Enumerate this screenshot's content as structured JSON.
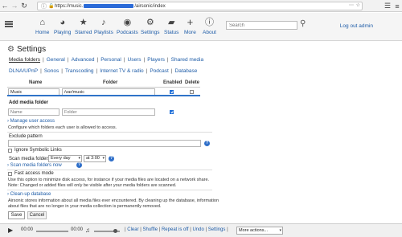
{
  "browser": {
    "back_icon": "arrow-left-icon",
    "forward_icon": "arrow-right-icon",
    "reload_icon": "reload-icon",
    "url_prefix": "https://music.",
    "url_suffix": "/airsonic/index",
    "overflow_icon": "ellipsis-icon",
    "bookmark_icon": "star-icon",
    "menu_icon": "hamburger-icon"
  },
  "header": {
    "nav": [
      {
        "label": "Home",
        "icon": "home-icon"
      },
      {
        "label": "Playing",
        "icon": "headphones-icon"
      },
      {
        "label": "Starred",
        "icon": "star-icon"
      },
      {
        "label": "Playlists",
        "icon": "music-note-icon"
      },
      {
        "label": "Podcasts",
        "icon": "podcast-icon"
      },
      {
        "label": "Settings",
        "icon": "gear-icon"
      },
      {
        "label": "Status",
        "icon": "status-icon"
      },
      {
        "label": "More",
        "icon": "plus-icon"
      },
      {
        "label": "About",
        "icon": "info-icon"
      }
    ],
    "search_placeholder": "Search",
    "logout": "Log out admin"
  },
  "settings": {
    "title": "Settings",
    "tabs_row1": [
      "Media folders",
      "General",
      "Advanced",
      "Personal",
      "Users",
      "Players",
      "Shared media"
    ],
    "tabs_row2": [
      "DLNA/UPnP",
      "Sonos",
      "Transcoding",
      "Internet TV & radio",
      "Podcast",
      "Database"
    ],
    "active_tab": "Media folders"
  },
  "folders": {
    "col_name": "Name",
    "col_folder": "Folder",
    "col_enabled": "Enabled",
    "col_delete": "Delete",
    "rows": [
      {
        "name": "Music",
        "folder": "/var/music",
        "enabled": true,
        "delete": false
      }
    ],
    "add_label": "Add media folder",
    "add_name_placeholder": "Name",
    "add_folder_placeholder": "Folder",
    "add_enabled": true
  },
  "user_access": {
    "link": "Manage user access",
    "desc": "Configure which folders each user is allowed to access."
  },
  "exclude": {
    "label": "Exclude pattern",
    "value": "",
    "ignore_symlinks_label": "Ignore Symbolic Links",
    "ignore_symlinks": false
  },
  "scan": {
    "label": "Scan media folders",
    "interval": "Every day",
    "time": "at 3:00",
    "scan_now": "Scan media folders now"
  },
  "fast_access": {
    "label": "Fast access mode",
    "checked": false,
    "desc1": "Use this option to minimize disk access, for instance if your media files are located on a network share.",
    "desc2": "Note: Changed or added files will only be visible after your media folders are scanned."
  },
  "cleanup": {
    "link": "Clean-up database",
    "desc1": "Airsonic stores information about all media files ever encountered. By cleaning up the database, information",
    "desc2": "about files that are no longer in your media collection is permanently removed."
  },
  "buttons": {
    "save": "Save",
    "cancel": "Cancel"
  },
  "player": {
    "time_current": "00:00",
    "time_total": "00:00",
    "clear": "Clear",
    "shuffle": "Shuffle",
    "repeat": "Repeat is off",
    "undo": "Undo",
    "settings": "Settings",
    "more_actions": "More actions..."
  },
  "colors": {
    "link": "#1f5da8",
    "accent": "#2f73c8"
  }
}
